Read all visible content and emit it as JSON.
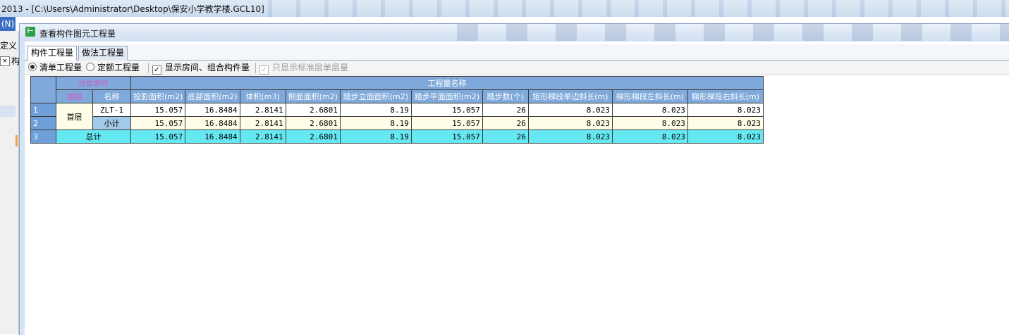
{
  "app": {
    "title": "2013 - [C:\\Users\\Administrator\\Desktop\\保安小学教学楼.GCL10]",
    "menu_fragment": "(N)",
    "define_fragment": "定义",
    "close_fragment": "×",
    "char_fragment": "构"
  },
  "dialog": {
    "title": "查看构件图元工程量",
    "icon_glyph": "⊢"
  },
  "tabs": [
    {
      "label": "构件工程量",
      "active": true
    },
    {
      "label": "做法工程量",
      "active": false
    }
  ],
  "options": {
    "list_qty": {
      "label": "清单工程量",
      "selected": true
    },
    "quota_qty": {
      "label": "定额工程量",
      "selected": false
    },
    "show_rooms": {
      "label": "显示房间、组合构件量",
      "checked": true,
      "check_glyph": "✓"
    },
    "std_floor_only": {
      "label": "只显示标准层单层量",
      "checked": true,
      "disabled": true,
      "check_glyph": "✓"
    }
  },
  "table": {
    "group_headers": {
      "category": "分类条件",
      "quantity": "工程量名称"
    },
    "sub_headers": {
      "floor": "楼层",
      "name": "名称"
    },
    "columns": [
      "投影面积(m2)",
      "底部面积(m2)",
      "体积(m3)",
      "侧面面积(m2)",
      "踏步立面面积(m2)",
      "踏步平面面积(m2)",
      "踏步数(个)",
      "矩形梯段单边斜长(m)",
      "梯形梯段左斜长(m)",
      "梯形梯段右斜长(m)"
    ],
    "floor": "首层",
    "rows": [
      {
        "num": "1",
        "name": "ZLT-1",
        "values": [
          "15.057",
          "16.8484",
          "2.8141",
          "2.6801",
          "8.19",
          "15.057",
          "26",
          "8.023",
          "8.023",
          "8.023"
        ]
      },
      {
        "num": "2",
        "name": "小计",
        "values": [
          "15.057",
          "16.8484",
          "2.8141",
          "2.6801",
          "8.19",
          "15.057",
          "26",
          "8.023",
          "8.023",
          "8.023"
        ]
      }
    ],
    "total": {
      "num": "3",
      "label": "总计",
      "values": [
        "15.057",
        "16.8484",
        "2.8141",
        "2.6801",
        "8.19",
        "15.057",
        "26",
        "8.023",
        "8.023",
        "8.023"
      ]
    }
  },
  "colors": {
    "header_bg": "#7fa9da",
    "subtotal_bg": "#a3c9ea",
    "total_bg": "#66e8f2",
    "category_text": "#d25cc7"
  }
}
